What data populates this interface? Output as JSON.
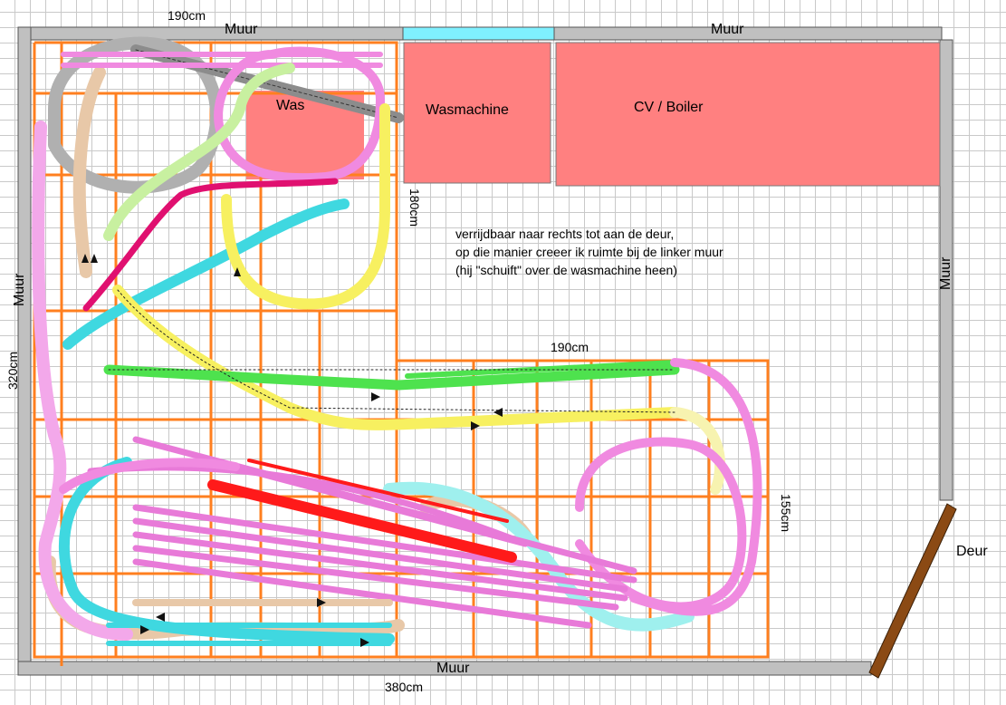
{
  "labels": {
    "top_dim": "190cm",
    "wall_top_left": "Muur",
    "wall_top_right": "Muur",
    "wall_left": "Muur",
    "wall_right": "Muur",
    "wall_bottom": "Muur",
    "left_dim": "320cm",
    "mid_dim_vertical": "180cm",
    "mid_dim_horizontal": "190cm",
    "right_dim": "155cm",
    "bottom_dim": "380cm",
    "washer_left": "Was",
    "washer_main": "Wasmachine",
    "boiler": "CV / Boiler",
    "door": "Deur"
  },
  "note": {
    "line1": "verrijdbaar naar rechts tot aan de deur,",
    "line2": "op die manier creeer ik ruimte bij de linker muur",
    "line3": "(hij \"schuift\" over de wasmachine heen)"
  },
  "colors": {
    "wall": "#c0c0c0",
    "window": "#7ff0ff",
    "appliance": "#ff8080",
    "frame": "#ff7f1f",
    "door": "#8b4a14",
    "track_pink": "#f08ae0",
    "track_cyan": "#3fd8e0",
    "track_green": "#4ee24e",
    "track_yellow": "#f7f060",
    "track_red": "#ff2020",
    "track_magenta": "#e01070",
    "track_tan": "#e8c8a8",
    "track_grey": "#a8a8a8"
  }
}
